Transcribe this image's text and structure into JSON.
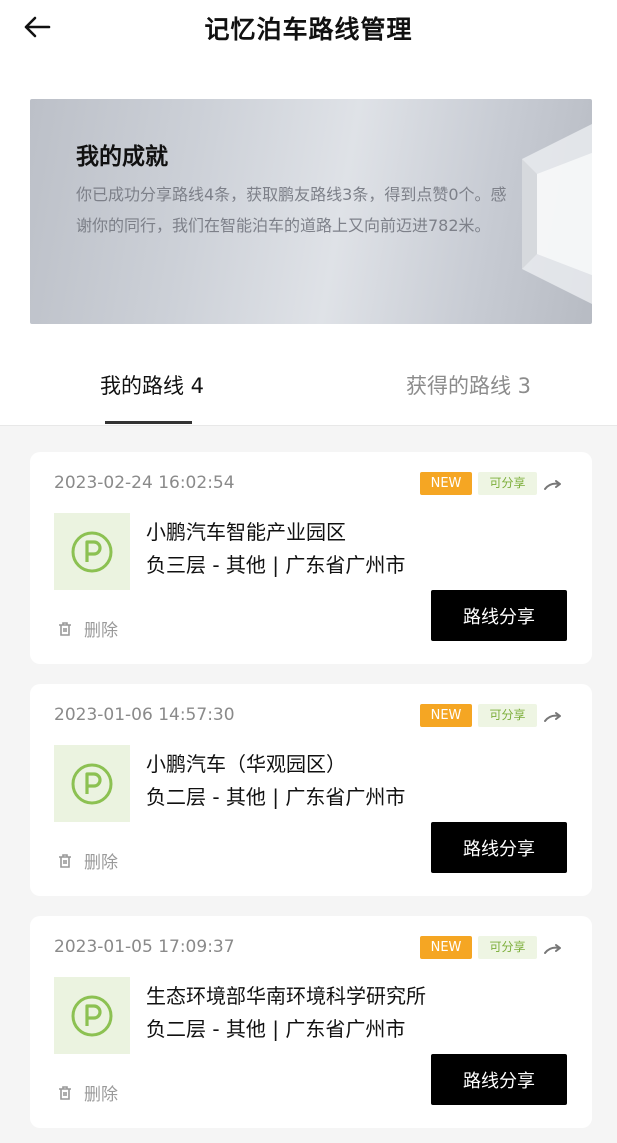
{
  "header": {
    "title": "记忆泊车路线管理"
  },
  "achievement": {
    "title": "我的成就",
    "text": "你已成功分享路线4条，获取鹏友路线3条，得到点赞0个。感谢你的同行，我们在智能泊车的道路上又向前迈进782米。"
  },
  "tabs": {
    "mine": "我的路线 4",
    "received": "获得的路线 3"
  },
  "routes": [
    {
      "time": "2023-02-24 16:02:54",
      "badge_new": "NEW",
      "badge_share": "可分享",
      "name": "小鹏汽车智能产业园区",
      "detail": "负三层 - 其他 | 广东省广州市",
      "delete_label": "删除",
      "share_label": "路线分享"
    },
    {
      "time": "2023-01-06 14:57:30",
      "badge_new": "NEW",
      "badge_share": "可分享",
      "name": "小鹏汽车（华观园区）",
      "detail": "负二层 - 其他 | 广东省广州市",
      "delete_label": "删除",
      "share_label": "路线分享"
    },
    {
      "time": "2023-01-05 17:09:37",
      "badge_new": "NEW",
      "badge_share": "可分享",
      "name": "生态环境部华南环境科学研究所",
      "detail": "负二层 - 其他 | 广东省广州市",
      "delete_label": "删除",
      "share_label": "路线分享"
    }
  ],
  "icons": {
    "back": "arrow-left-icon",
    "parking": "parking-icon",
    "delete": "trash-icon",
    "share": "share-arrow-icon"
  },
  "colors": {
    "badge_new_bg": "#f5a623",
    "badge_share_bg": "#eef5e3",
    "badge_share_text": "#7cae3a",
    "parking_green": "#8cc152",
    "button_bg": "#000000"
  }
}
